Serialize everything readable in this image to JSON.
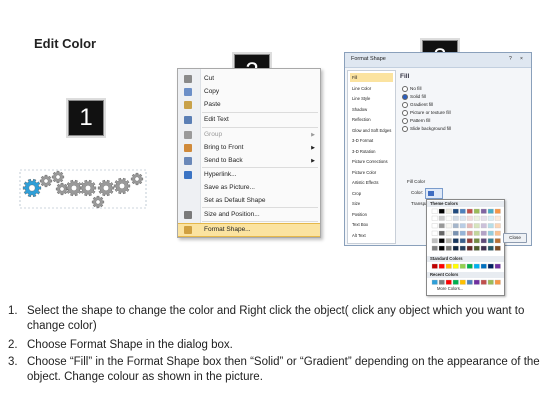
{
  "title": "Edit Color",
  "badges": [
    "1",
    "2",
    "3"
  ],
  "gear_colors": {
    "active": "#2f9fd8",
    "inactive": "#9a9a9a"
  },
  "context_menu": {
    "items": [
      {
        "label": "Cut",
        "icon": "scissors-icon",
        "disabled": false,
        "submenu": false
      },
      {
        "label": "Copy",
        "icon": "copy-icon",
        "disabled": false,
        "submenu": false
      },
      {
        "label": "Paste",
        "icon": "paste-icon",
        "disabled": false,
        "submenu": false
      },
      {
        "label": "Edit Text",
        "icon": "edit-text-icon",
        "disabled": false,
        "submenu": false
      },
      {
        "label": "Group",
        "icon": "group-icon",
        "disabled": true,
        "submenu": true
      },
      {
        "label": "Bring to Front",
        "icon": "bring-front-icon",
        "disabled": false,
        "submenu": true
      },
      {
        "label": "Send to Back",
        "icon": "send-back-icon",
        "disabled": false,
        "submenu": true
      },
      {
        "label": "Hyperlink...",
        "icon": "hyperlink-icon",
        "disabled": false,
        "submenu": false
      },
      {
        "label": "Save as Picture...",
        "icon": "",
        "disabled": false,
        "submenu": false
      },
      {
        "label": "Set as Default Shape",
        "icon": "",
        "disabled": false,
        "submenu": false
      },
      {
        "label": "Size and Position...",
        "icon": "size-icon",
        "disabled": false,
        "submenu": false
      },
      {
        "label": "Format Shape...",
        "icon": "format-shape-icon",
        "disabled": false,
        "submenu": false,
        "highlighted": true
      }
    ]
  },
  "dialog": {
    "title": "Format Shape",
    "help_button": "?",
    "close_icon_glyph": "×",
    "categories": [
      "Fill",
      "Line Color",
      "Line Style",
      "Shadow",
      "Reflection",
      "Glow and Soft Edges",
      "3-D Format",
      "3-D Rotation",
      "Picture Corrections",
      "Picture Color",
      "Artistic Effects",
      "Crop",
      "Size",
      "Position",
      "Text Box",
      "Alt Text"
    ],
    "selected_category": "Fill",
    "fill_heading": "Fill",
    "fill_options": [
      "No fill",
      "Solid fill",
      "Gradient fill",
      "Picture or texture fill",
      "Pattern fill",
      "Slide background fill"
    ],
    "selected_fill": "Solid fill",
    "fill_color_label": "Fill Color",
    "color_label": "Color:",
    "transparency_label": "Transparency:",
    "current_color": "#3f6dc2",
    "palette": {
      "theme_heading": "Theme Colors",
      "standard_heading": "Standard Colors",
      "recent_heading": "Recent Colors",
      "more_label": "More Colors...",
      "theme_top": [
        "#ffffff",
        "#000000",
        "#eeece1",
        "#1f497d",
        "#4f81bd",
        "#c0504d",
        "#9bbb59",
        "#8064a2",
        "#4bacc6",
        "#f79646"
      ],
      "standard": [
        "#c00000",
        "#ff0000",
        "#ffc000",
        "#ffff00",
        "#92d050",
        "#00b050",
        "#00b0f0",
        "#0070c0",
        "#002060",
        "#7030a0"
      ],
      "recent": [
        "#2f9fd8",
        "#7f7f7f",
        "#ff0000",
        "#00b050",
        "#ffc000",
        "#4f81bd",
        "#7030a0",
        "#c0504d",
        "#9bbb59",
        "#f79646"
      ]
    },
    "close_button": "Close"
  },
  "instructions": [
    {
      "num": "1.",
      "text": "Select the shape to change the color and Right click the object( click any object which you want to change color)"
    },
    {
      "num": "2.",
      "text": "Choose Format Shape in the dialog box."
    },
    {
      "num": "3.",
      "text": "Choose “Fill” in the Format Shape box then “Solid” or “Gradient” depending on the appearance of the object. Change colour as shown in the picture."
    }
  ]
}
